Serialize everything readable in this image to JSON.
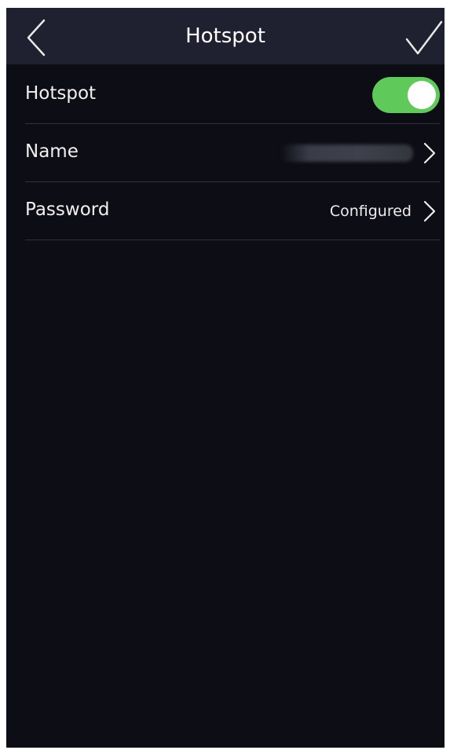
{
  "header": {
    "title": "Hotspot",
    "back_icon": "chevron-left-icon",
    "confirm_icon": "checkmark-icon"
  },
  "settings": {
    "hotspot": {
      "label": "Hotspot",
      "enabled": true,
      "toggle_color": "#5fc95a"
    },
    "name": {
      "label": "Name",
      "value_state": "obscured"
    },
    "password": {
      "label": "Password",
      "value": "Configured"
    }
  },
  "colors": {
    "background": "#0d0d15",
    "header_background": "#1f2131",
    "divider": "#2f3140",
    "text": "#f0f0f0"
  }
}
